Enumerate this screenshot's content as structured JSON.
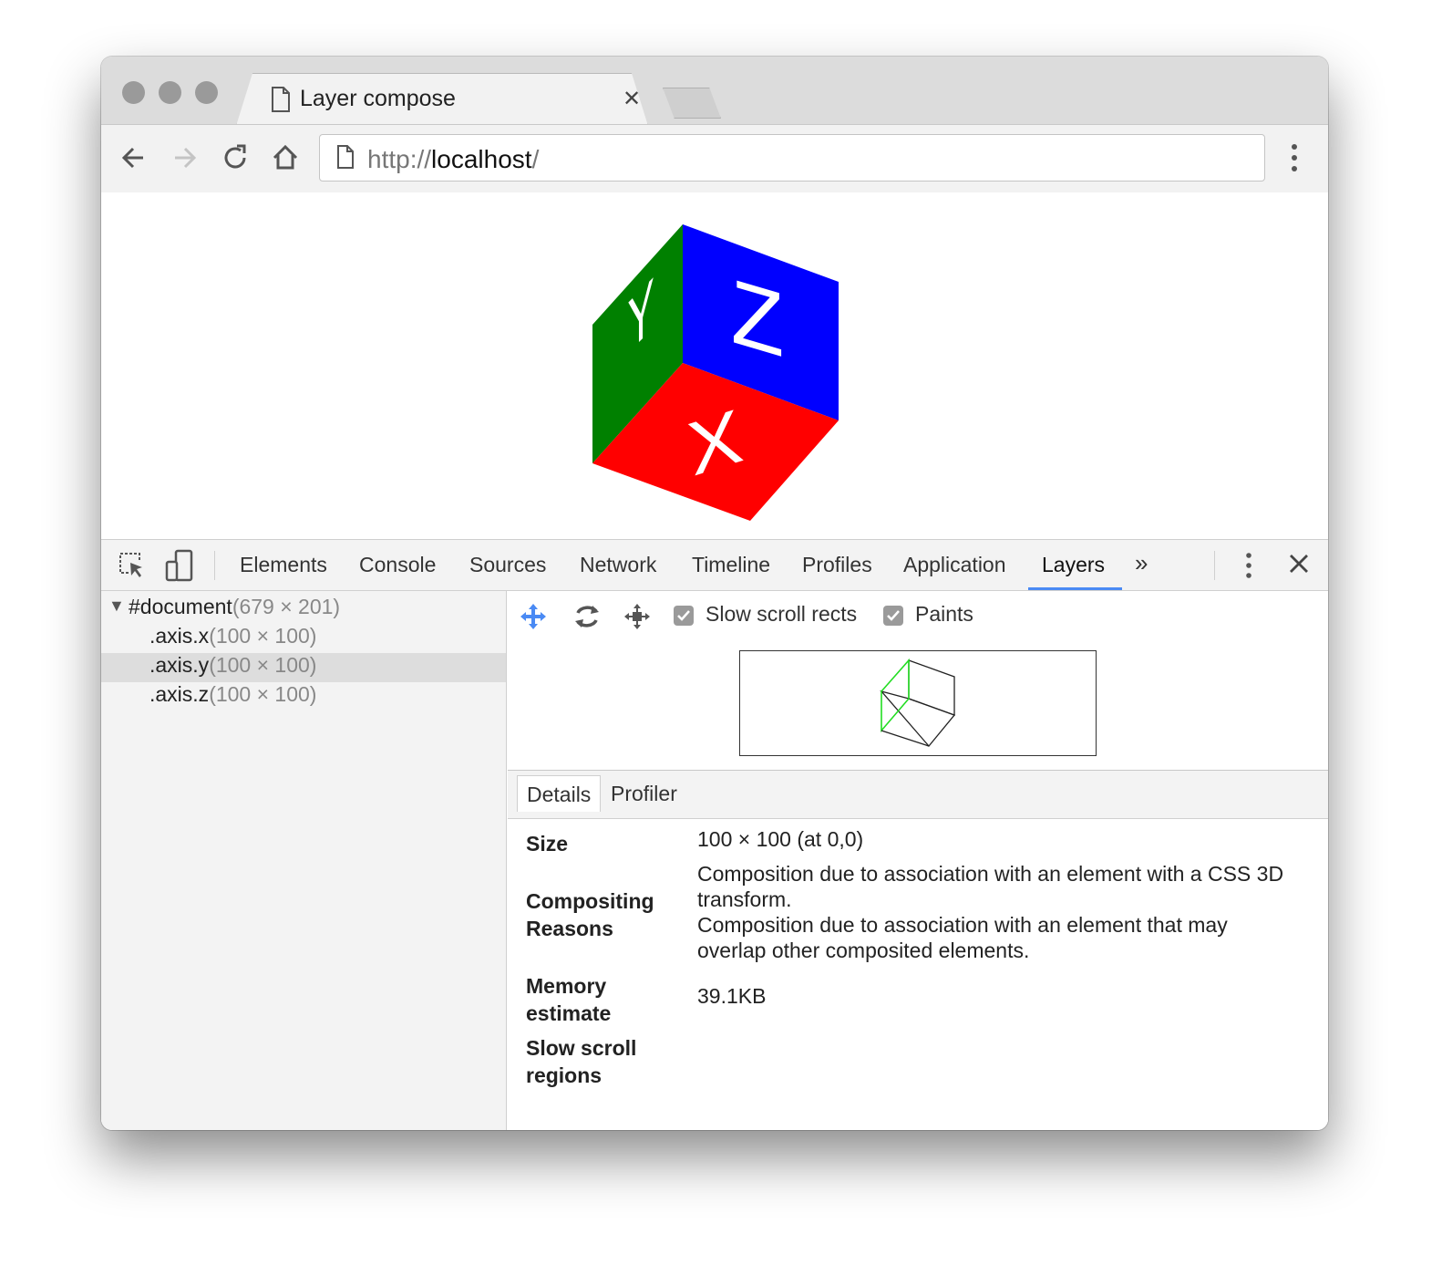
{
  "browser": {
    "tab_title": "Layer compose",
    "url_scheme": "http://",
    "url_host": "localhost",
    "url_suffix": "/"
  },
  "page": {
    "cube_faces": {
      "y_label": "Y",
      "z_label": "Z",
      "x_label": "X"
    },
    "colors": {
      "y_face": "#008000",
      "z_face": "#0000ff",
      "x_face": "#ff0000"
    }
  },
  "devtools": {
    "tabs": [
      "Elements",
      "Console",
      "Sources",
      "Network",
      "Timeline",
      "Profiles",
      "Application",
      "Layers"
    ],
    "active_tab": "Layers",
    "more_tabs": "»",
    "layer_tree": [
      {
        "name": "#document",
        "dims": "(679 × 201)"
      },
      {
        "name": ".axis.x",
        "dims": "(100 × 100)"
      },
      {
        "name": ".axis.y",
        "dims": "(100 × 100)"
      },
      {
        "name": ".axis.z",
        "dims": "(100 × 100)"
      }
    ],
    "selected_layer": ".axis.y",
    "toolbar": {
      "slow_scroll_label": "Slow scroll rects",
      "paints_label": "Paints"
    },
    "detail_tabs": [
      "Details",
      "Profiler"
    ],
    "details": {
      "size_label": "Size",
      "size_value": "100 × 100 (at 0,0)",
      "compositing_label_1": "Compositing",
      "compositing_label_2": "Reasons",
      "reason_1a": "Composition due to association with an element with a CSS 3D",
      "reason_1b": "transform.",
      "reason_2a": "Composition due to association with an element that may",
      "reason_2b": "overlap other composited elements.",
      "memory_label_1": "Memory",
      "memory_label_2": "estimate",
      "memory_value": "39.1KB",
      "slow_scroll_label_1": "Slow scroll",
      "slow_scroll_label_2": "regions"
    },
    "accent_color": "#4a8af4"
  }
}
